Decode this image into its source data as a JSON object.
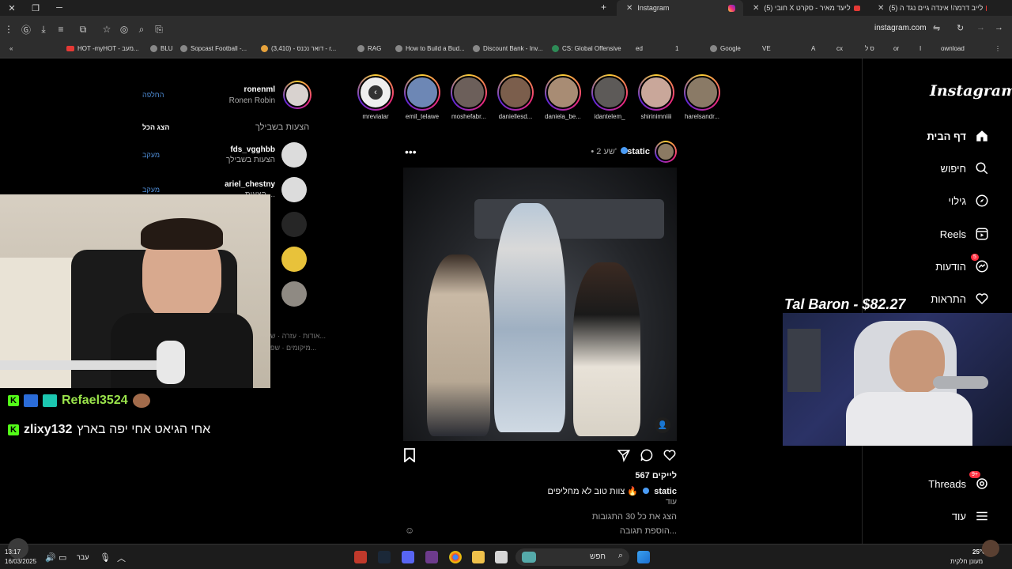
{
  "browser": {
    "tabs": [
      {
        "title": "(5) לייב דרמה! אינדה גיים נגד ה",
        "active": false
      },
      {
        "title": "(5) חובי X ליעד מאיר - סקרט",
        "active": false
      },
      {
        "title": "Instagram",
        "active": true
      }
    ],
    "url": "instagram.com",
    "bookmarks": [
      "HOT -myHOT - מעב...",
      "BLU",
      "Sopcast Football -...",
      "(3,410) - דואר נכנס - r...",
      "RAG",
      "How to Build a Bud...",
      "Discount Bank - Inv...",
      "CS: Global Offensive",
      "ed",
      "1",
      "Google",
      "VE",
      "A",
      "cx",
      "ס ל",
      "or",
      "I",
      "ownload"
    ]
  },
  "instagram": {
    "logo": "Instagram",
    "nav": [
      {
        "label": "דף הבית",
        "icon": "home-icon"
      },
      {
        "label": "חיפוש",
        "icon": "search-icon"
      },
      {
        "label": "גילוי",
        "icon": "compass-icon"
      },
      {
        "label": "Reels",
        "icon": "reels-icon"
      },
      {
        "label": "הודעות",
        "icon": "messenger-icon",
        "badge": "5"
      },
      {
        "label": "התראות",
        "icon": "heart-icon"
      },
      {
        "label": "Threads",
        "icon": "threads-icon",
        "badge": "9+"
      },
      {
        "label": "עוד",
        "icon": "menu-icon"
      }
    ],
    "stories": [
      "harelsandr...",
      "shirinimniiii",
      "idantelem_",
      "daniela_be...",
      "daniellesd...",
      "moshefabr...",
      "emil_telawe",
      "mreviatar"
    ],
    "post": {
      "username": "static",
      "time": "• 2 שע'",
      "likes": "567 לייקים",
      "caption_user": "static",
      "caption_text": "צוות טוב לא מחליפים 🔥",
      "more": "עוד",
      "view_comments": "הצג את כל 30 התגובות",
      "add_comment": "הוספת תגובה..."
    },
    "sidebar": {
      "current_user": {
        "username": "ronenml",
        "name": "Ronen Robin",
        "action": "החלפה"
      },
      "suggestions_title": "הצעות בשבילך",
      "see_all": "הצג הכל",
      "suggestions": [
        {
          "username": "fds_vgghbb",
          "sub": "הצעות בשבילך",
          "action": "מעקב"
        },
        {
          "username": "ariel_chestny",
          "sub": "הצעות ...",
          "action": "מעקב"
        }
      ],
      "footer": "אודות · עזרה · ש...",
      "footer2": "מיקומים · שפ..."
    }
  },
  "overlay": {
    "donation": "Tal Baron - $82.27",
    "chat": [
      {
        "user": "Refael3524",
        "message": ""
      },
      {
        "user": "zlixy132",
        "message": "אחי הגיאט אחי יפה בארץ"
      }
    ]
  },
  "taskbar": {
    "time": "13:17",
    "date": "16/03/2025",
    "lang": "עבר",
    "search_label": "חפש",
    "weather_temp": "25°C",
    "weather_desc": "מעונן חלקית"
  }
}
